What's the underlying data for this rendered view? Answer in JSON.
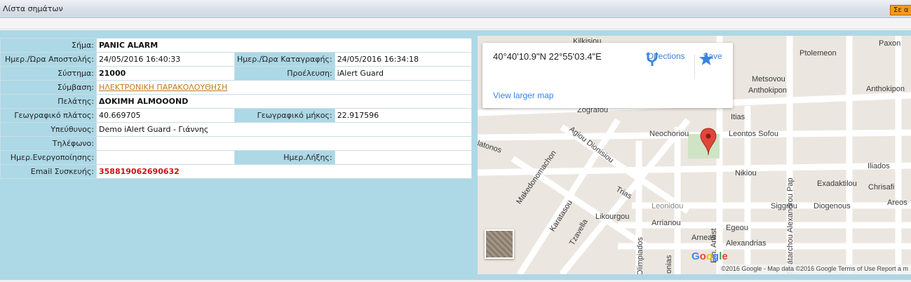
{
  "window": {
    "title": "Λίστα σημάτων",
    "orange_button": "Σε α"
  },
  "details": {
    "signal_label": "Σήμα:",
    "signal_value": "PANIC ALARM",
    "sent_label": "Ημερ./Ώρα Αποστολής:",
    "sent_value": "24/05/2016 16:40:33",
    "recorded_label": "Ημερ./Ώρα Καταγραφής:",
    "recorded_value": "24/05/2016 16:34:18",
    "system_label": "Σύστημα:",
    "system_value": "21000",
    "origin_label": "Προέλευση:",
    "origin_value": "iAlert Guard",
    "contract_label": "Σύμβαση:",
    "contract_value": "ΗΛΕΚΤΡΟΝΙΚΗ ΠΑΡΑΚΟΛΟΥΘΗΣΗ",
    "client_label": "Πελάτης:",
    "client_value": "ΔΟΚΙΜΗ ALMOOOND",
    "lat_label": "Γεωγραφικό πλάτος:",
    "lat_value": "40.669705",
    "lon_label": "Γεωγραφικό μήκος:",
    "lon_value": "22.917596",
    "responsible_label": "Υπεύθυνος:",
    "responsible_value": "Demo iAlert Guard - Γιάννης",
    "phone_label": "Τηλέφωνο:",
    "phone_value": "",
    "activation_label": "Ημερ.Ενεργοποίησης:",
    "activation_value": "",
    "expiry_label": "Ημερ.Λήξης:",
    "expiry_value": "",
    "email_label": "Email Συσκευής:",
    "email_value": "358819062690632"
  },
  "map": {
    "coords": "40°40'10.9\"N 22°55'03.4\"E",
    "directions": "Directions",
    "save": "Save",
    "view_larger": "View larger map",
    "google": "Google",
    "attribution": "©2016 Google - Map data ©2016 Google   Terms of Use   Report a m",
    "streets": [
      "Kilkisiou",
      "Ptolemeon",
      "Paxon",
      "Metsovou",
      "Anthokipon",
      "Anthokipon",
      "Zografou",
      "Itias",
      "Neochoriou",
      "Leontos Sofou",
      "Agiou Dionisiou",
      "Makedonomachon",
      "latonos",
      "Nikiou",
      "Iliados",
      "Exadaktilou",
      "Chrisafi",
      "Trias",
      "Karatasou",
      "Areos",
      "Siggrou",
      "Diogenous",
      "Tzavella",
      "Likourgou",
      "Leonidou",
      "Arrianou",
      "Egeou",
      "Arneas",
      "Alexandrias",
      "Olimpiados",
      "Ionias",
      "Eth. Antist",
      "Strátarchou Alexandrou Pap"
    ],
    "accent_blue": "#3a84df",
    "pin_color": "#e0463b"
  }
}
